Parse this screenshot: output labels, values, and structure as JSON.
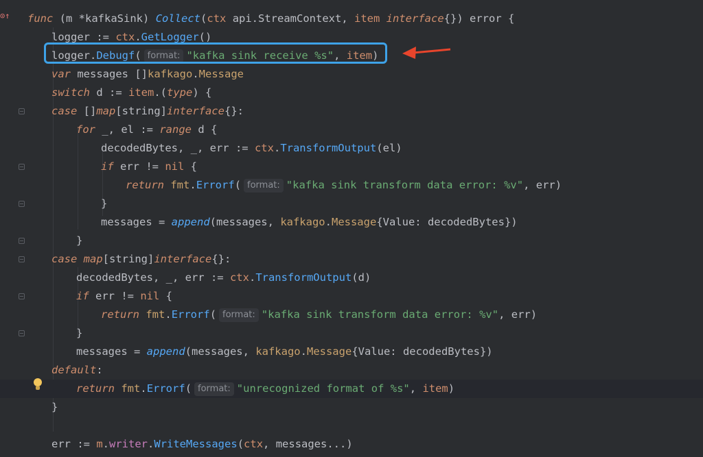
{
  "gutter": {
    "icon": "override-up-arrow-icon"
  },
  "lines": [
    {
      "tokens": [
        [
          "kw",
          "func"
        ],
        [
          "pl",
          " ("
        ],
        [
          "pl",
          "m "
        ],
        [
          "pl",
          "*"
        ],
        [
          "ty",
          "kafkaSink"
        ],
        [
          "pl",
          ") "
        ],
        [
          "fni",
          "Collect"
        ],
        [
          "pl",
          "("
        ],
        [
          "rcv",
          "ctx"
        ],
        [
          "pl",
          " api.StreamContext, "
        ],
        [
          "rcv",
          "item"
        ],
        [
          "pl",
          " "
        ],
        [
          "kw",
          "interface"
        ],
        [
          "pl",
          "{}) error {"
        ]
      ]
    },
    {
      "tokens": [
        [
          "pl",
          "logger := "
        ],
        [
          "rcv",
          "ctx"
        ],
        [
          "pl",
          "."
        ],
        [
          "fn",
          "GetLogger"
        ],
        [
          "pl",
          "()"
        ]
      ]
    },
    {
      "tokens": [
        [
          "pl",
          "logger."
        ],
        [
          "fn",
          "Debugf"
        ],
        [
          "pl",
          "("
        ],
        [
          "hint",
          "format:"
        ],
        [
          "str",
          "\"kafka sink receive %s\""
        ],
        [
          "pl",
          ", "
        ],
        [
          "rcv",
          "item"
        ],
        [
          "pl",
          ")"
        ]
      ]
    },
    {
      "tokens": [
        [
          "kw",
          "var"
        ],
        [
          "pl",
          " messages []"
        ],
        [
          "pkg",
          "kafkago"
        ],
        [
          "pl",
          "."
        ],
        [
          "pkg",
          "Message"
        ]
      ]
    },
    {
      "tokens": [
        [
          "kw",
          "switch"
        ],
        [
          "pl",
          " d := "
        ],
        [
          "rcv",
          "item"
        ],
        [
          "pl",
          ".("
        ],
        [
          "kw",
          "type"
        ],
        [
          "pl",
          ") {"
        ]
      ]
    },
    {
      "tokens": [
        [
          "kw",
          "case"
        ],
        [
          "pl",
          " []"
        ],
        [
          "kw",
          "map"
        ],
        [
          "pl",
          "[string]"
        ],
        [
          "kw",
          "interface"
        ],
        [
          "pl",
          "{}:"
        ]
      ]
    },
    {
      "tokens": [
        [
          "kw",
          "for"
        ],
        [
          "pl",
          " _, el := "
        ],
        [
          "kw",
          "range"
        ],
        [
          "pl",
          " d {"
        ]
      ]
    },
    {
      "tokens": [
        [
          "pl",
          "decodedBytes, _, err := "
        ],
        [
          "rcv",
          "ctx"
        ],
        [
          "pl",
          "."
        ],
        [
          "fn",
          "TransformOutput"
        ],
        [
          "pl",
          "(el)"
        ]
      ]
    },
    {
      "tokens": [
        [
          "kw",
          "if"
        ],
        [
          "pl",
          " err != "
        ],
        [
          "kwn",
          "nil"
        ],
        [
          "pl",
          " {"
        ]
      ]
    },
    {
      "tokens": [
        [
          "kw",
          "return"
        ],
        [
          "pl",
          " "
        ],
        [
          "pkg",
          "fmt"
        ],
        [
          "pl",
          "."
        ],
        [
          "fn",
          "Errorf"
        ],
        [
          "pl",
          "("
        ],
        [
          "hint",
          "format:"
        ],
        [
          "str",
          "\"kafka sink transform data error: %v\""
        ],
        [
          "pl",
          ", err)"
        ]
      ]
    },
    {
      "tokens": [
        [
          "pl",
          "}"
        ]
      ]
    },
    {
      "tokens": [
        [
          "pl",
          "messages = "
        ],
        [
          "fni",
          "append"
        ],
        [
          "pl",
          "(messages, "
        ],
        [
          "pkg",
          "kafkago"
        ],
        [
          "pl",
          "."
        ],
        [
          "pkg",
          "Message"
        ],
        [
          "pl",
          "{Value: decodedBytes})"
        ]
      ]
    },
    {
      "tokens": [
        [
          "pl",
          "}"
        ]
      ]
    },
    {
      "tokens": [
        [
          "kw",
          "case"
        ],
        [
          "pl",
          " "
        ],
        [
          "kw",
          "map"
        ],
        [
          "pl",
          "[string]"
        ],
        [
          "kw",
          "interface"
        ],
        [
          "pl",
          "{}:"
        ]
      ]
    },
    {
      "tokens": [
        [
          "pl",
          "decodedBytes, _, err := "
        ],
        [
          "rcv",
          "ctx"
        ],
        [
          "pl",
          "."
        ],
        [
          "fn",
          "TransformOutput"
        ],
        [
          "pl",
          "(d)"
        ]
      ]
    },
    {
      "tokens": [
        [
          "kw",
          "if"
        ],
        [
          "pl",
          " err != "
        ],
        [
          "kwn",
          "nil"
        ],
        [
          "pl",
          " {"
        ]
      ]
    },
    {
      "tokens": [
        [
          "kw",
          "return"
        ],
        [
          "pl",
          " "
        ],
        [
          "pkg",
          "fmt"
        ],
        [
          "pl",
          "."
        ],
        [
          "fn",
          "Errorf"
        ],
        [
          "pl",
          "("
        ],
        [
          "hint",
          "format:"
        ],
        [
          "str",
          "\"kafka sink transform data error: %v\""
        ],
        [
          "pl",
          ", err)"
        ]
      ]
    },
    {
      "tokens": [
        [
          "pl",
          "}"
        ]
      ]
    },
    {
      "tokens": [
        [
          "pl",
          "messages = "
        ],
        [
          "fni",
          "append"
        ],
        [
          "pl",
          "(messages, "
        ],
        [
          "pkg",
          "kafkago"
        ],
        [
          "pl",
          "."
        ],
        [
          "pkg",
          "Message"
        ],
        [
          "pl",
          "{Value: decodedBytes})"
        ]
      ]
    },
    {
      "tokens": [
        [
          "kw",
          "default"
        ],
        [
          "pl",
          ":"
        ]
      ]
    },
    {
      "tokens": [
        [
          "kw",
          "return"
        ],
        [
          "pl",
          " "
        ],
        [
          "pkg",
          "fmt"
        ],
        [
          "pl",
          "."
        ],
        [
          "fn",
          "Errorf"
        ],
        [
          "pl",
          "("
        ],
        [
          "hint",
          "format:"
        ],
        [
          "str",
          "\"unrecognized format of %s\""
        ],
        [
          "pl",
          ", "
        ],
        [
          "rcv",
          "item"
        ],
        [
          "pl",
          ")"
        ]
      ]
    },
    {
      "tokens": [
        [
          "pl",
          "}"
        ]
      ]
    },
    {
      "tokens": []
    },
    {
      "tokens": [
        [
          "pl",
          "err := "
        ],
        [
          "rcv",
          "m"
        ],
        [
          "pl",
          "."
        ],
        [
          "fld",
          "writer"
        ],
        [
          "pl",
          "."
        ],
        [
          "fn",
          "WriteMessages"
        ],
        [
          "pl",
          "("
        ],
        [
          "rcv",
          "ctx"
        ],
        [
          "pl",
          ", messages...)"
        ]
      ]
    }
  ],
  "annotation": {
    "box_color": "#3ea2e8",
    "arrow_color": "#e8452c"
  },
  "colors": {
    "background": "#2b2d30",
    "keyword": "#cf8e6d",
    "function": "#56a8f5",
    "string": "#6aab73",
    "package": "#c9a26d"
  }
}
